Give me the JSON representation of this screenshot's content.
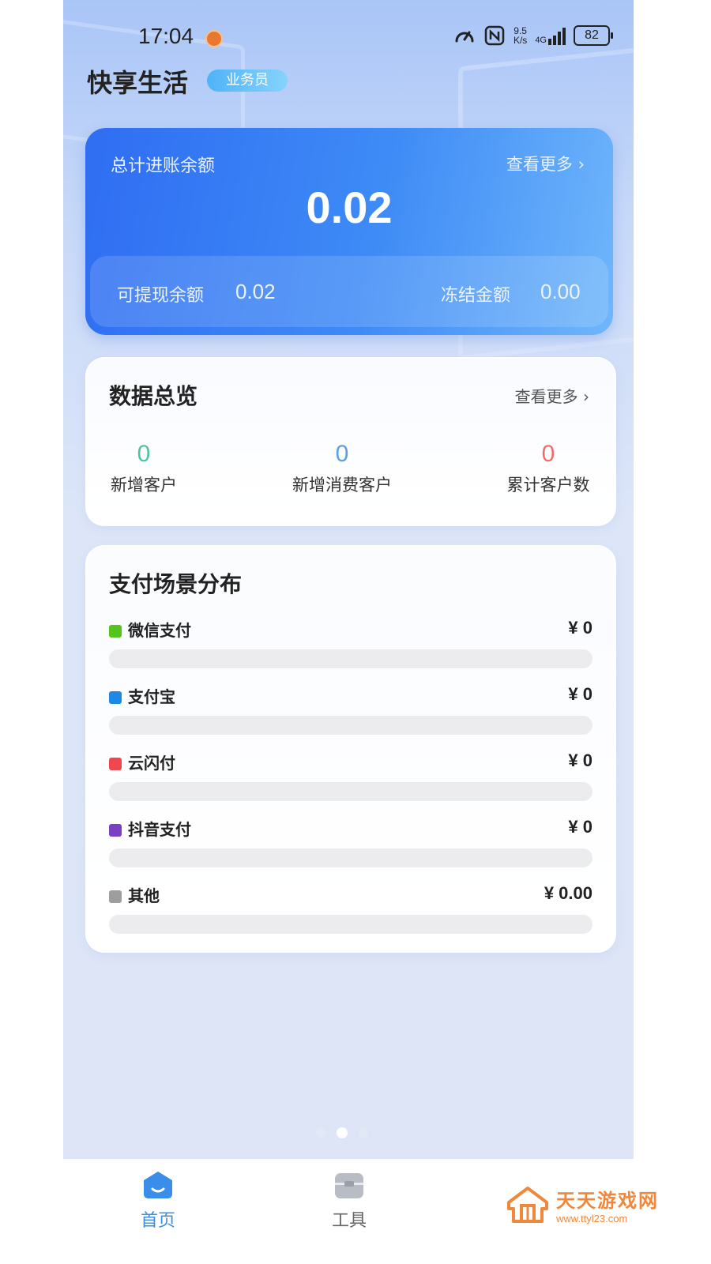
{
  "status_bar": {
    "time": "17:04",
    "net_rate_value": "9.5",
    "net_rate_unit": "K/s",
    "network": "4G",
    "battery": "82"
  },
  "header": {
    "app_title": "快享生活",
    "role_badge": "业务员"
  },
  "balance_card": {
    "label": "总计进账余额",
    "more_label": "查看更多",
    "amount": "0.02",
    "withdrawable_label": "可提现余额",
    "withdrawable_value": "0.02",
    "frozen_label": "冻结金额",
    "frozen_value": "0.00"
  },
  "overview": {
    "title": "数据总览",
    "more_label": "查看更多",
    "stats": [
      {
        "value": "0",
        "label": "新增客户",
        "color": "#4fc39a"
      },
      {
        "value": "0",
        "label": "新增消费客户",
        "color": "#5b9ee8"
      },
      {
        "value": "0",
        "label": "累计客户数",
        "color": "#f06b6b"
      }
    ]
  },
  "payment": {
    "title": "支付场景分布",
    "items": [
      {
        "name": "微信支付",
        "amount": "¥ 0",
        "color": "#52c41a",
        "share": 0
      },
      {
        "name": "支付宝",
        "amount": "¥ 0",
        "color": "#1e88e5",
        "share": 0
      },
      {
        "name": "云闪付",
        "amount": "¥ 0",
        "color": "#f0474f",
        "share": 0
      },
      {
        "name": "抖音支付",
        "amount": "¥ 0",
        "color": "#7b3fc4",
        "share": 0
      },
      {
        "name": "其他",
        "amount": "¥ 0.00",
        "color": "#9e9e9e",
        "share": 0
      }
    ]
  },
  "pager": {
    "count": 3,
    "active": 1
  },
  "tabbar": {
    "tabs": [
      {
        "label": "首页",
        "active": true,
        "color": "#3a8de8"
      },
      {
        "label": "工具",
        "active": false,
        "color": "#666666"
      }
    ]
  },
  "watermark": {
    "title": "天天游戏网",
    "url": "www.ttyl23.com",
    "color": "#f0873b"
  }
}
